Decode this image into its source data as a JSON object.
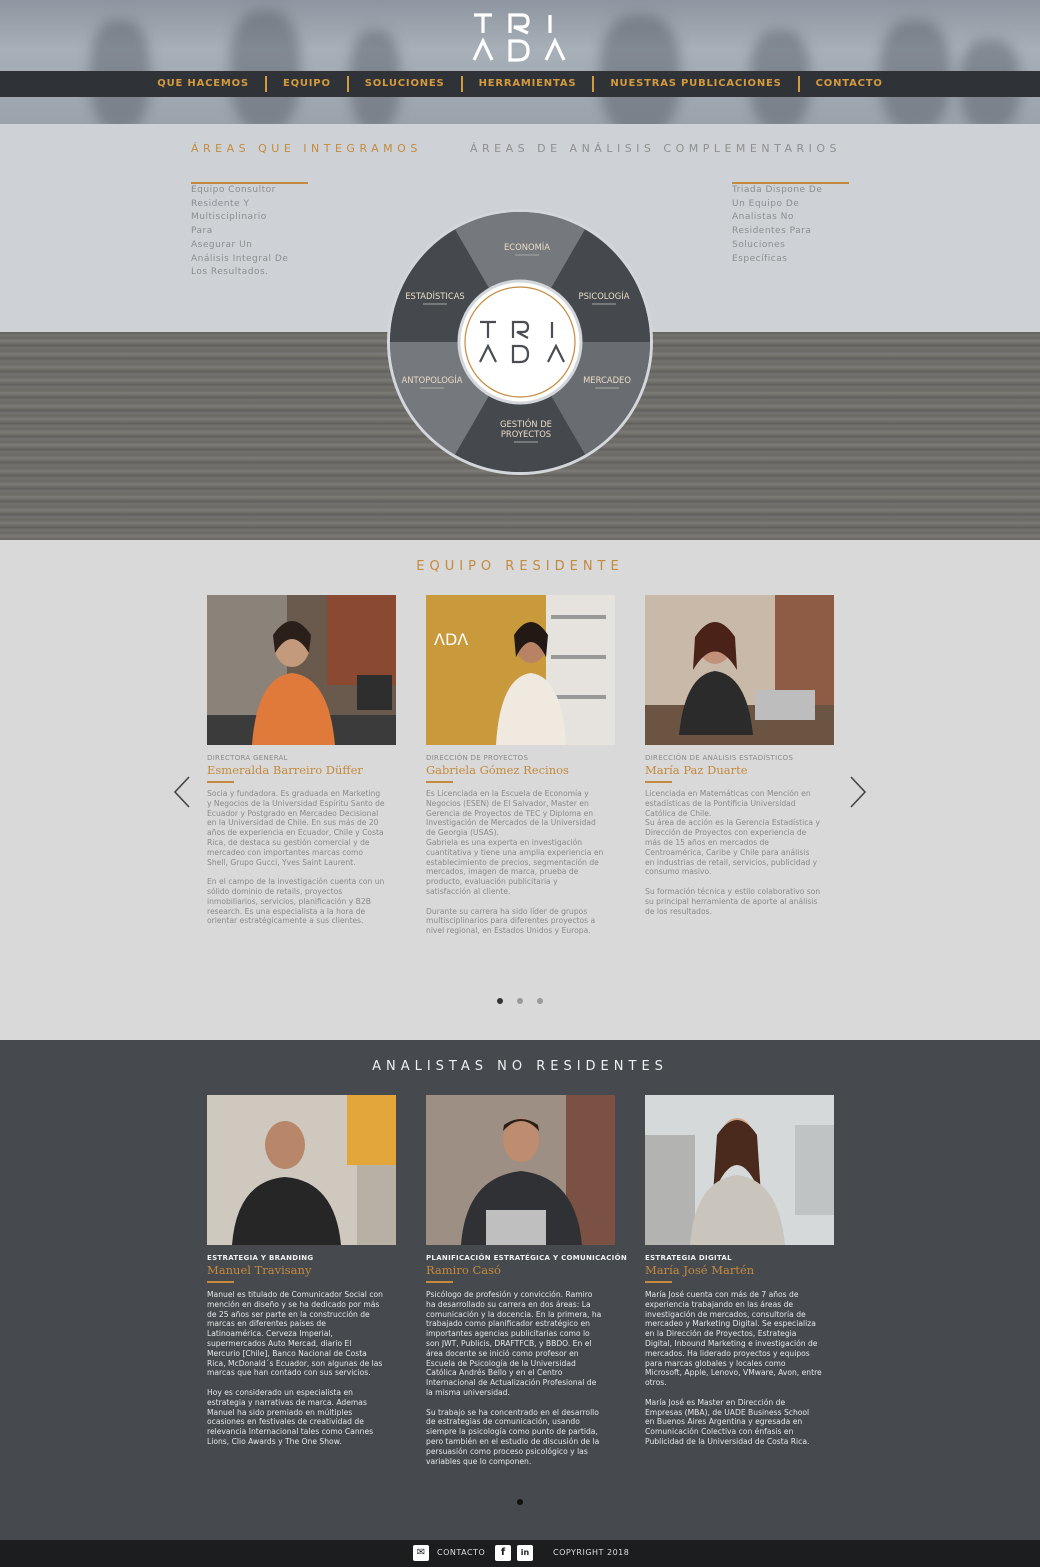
{
  "brand": {
    "logo_line1": "TRI",
    "logo_line2": "ADA",
    "accent_color": "#c48a3d"
  },
  "nav": {
    "items": [
      "QUE HACEMOS",
      "EQUIPO",
      "SOLUCIONES",
      "HERRAMIENTAS",
      "NUESTRAS PUBLICACIONES",
      "CONTACTO"
    ]
  },
  "areas": {
    "left_title": "ÁREAS QUE INTEGRAMOS",
    "right_title": "ÁREAS DE ANÁLISIS COMPLEMENTARIOS",
    "left_text": "Equipo Consultor\nResidente Y\nMultisciplinario Para\nAsegurar Un\nAnálisis Integral De\nLos Resultados.",
    "right_text": "Triada Dispone De\nUn Equipo De\nAnalistas No\nResidentes Para\nSoluciones\nEspecíficas",
    "wheel": [
      "ECONOMÍA",
      "PSICOLOGÍA",
      "MERCADEO",
      "GESTIÓN DE",
      "PROYECTOS",
      "ANTOPOLOGÍA",
      "ESTADÍSTICAS"
    ]
  },
  "team": {
    "title": "EQUIPO RESIDENTE",
    "members": [
      {
        "role": "DIRECTORA GENERAL",
        "name": "Esmeralda Barreiro Düffer",
        "bio": "Socia y fundadora. Es graduada en Marketing\ny Negocios de la Universidad Espíritu Santo de\nEcuador y Postgrado en Mercadeo Decisional\nen la Universidad de Chile. En sus más de 20\naños de experiencia en Ecuador, Chile y Costa\nRica, de destaca su gestión comercial y de\nmercadeo con importantes marcas como\nShell, Grupo Gucci, Yves Saint Laurent.\n\nEn el campo de la investigación cuenta con un\nsólido dominio de retails, proyectos\ninmobiliarios, servicios, planificación y B2B\nresearch. Es una especialista a la hora de\norientar estratégicamente a sus clientes."
      },
      {
        "role": "DIRECCIÓN DE PROYECTOS",
        "name": "Gabriela Gómez Recinos",
        "bio": "Es Licenciada en la Escuela de Economía y\nNegocios (ESEN) de El Salvador, Master en\nGerencia de Proyectos de TEC y Diploma en\nInvestigación de Mercados de la Universidad\nde Georgia (USAS).\nGabriela es una experta en investigación\ncuantitativa y tiene una amplia experiencia en\nestablecimiento de precios, segmentación de\nmercados, imagen de marca, prueba de\nproducto, evaluación publicitaria y\nsatisfacción al cliente.\n\nDurante su carrera ha sido líder de grupos\nmultisciplinarios para diferentes proyectos a\nnivel regional, en Estados Unidos y Europa."
      },
      {
        "role": "DIRECCIÓN DE ANÁLISIS ESTADÍSTICOS",
        "name": "María Paz Duarte",
        "bio": "Licenciada en Matemáticas con Mención en\nestadísticas de la Pontificia Universidad\nCatólica de Chile.\nSu área de acción es la Gerencia Estadística y\nDirección de Proyectos con experiencia de\nmás de 15 años en mercados de\nCentroamérica, Caribe y Chile para análisis\nen industrias de retail, servicios, publicidad y\nconsumo masivo.\n\nSu formación técnica y estilo colaborativo son\nsu principal herramienta de aporte al análisis\nde los resultados."
      }
    ]
  },
  "analysts": {
    "title": "ANALISTAS NO RESIDENTES",
    "members": [
      {
        "role": "ESTRATEGIA Y BRANDING",
        "name": "Manuel Travisany",
        "bio": "Manuel es titulado de Comunicador Social con\nmención en diseño y se ha dedicado por más\nde 25 años ser parte en la construcción de\nmarcas en diferentes países de\nLatinoamérica. Cerveza Imperial,\nsupermercados Auto Mercad, diario El\nMercurio [Chile], Banco Nacional de Costa\nRica, McDonald´s Ecuador, son algunas de las\nmarcas que han contado con sus servicios.\n\nHoy es considerado un especialista en\nestrategia y narrativas de marca. Ademas\nManuel ha sido premiado en múltiples\nocasiones en festivales de creatividad de\nrelevancia Internacional tales como Cannes\nLions, Clio Awards y The One Show."
      },
      {
        "role": "PLANIFICACIÓN ESTRATÉGICA Y COMUNICACIÓN",
        "name": "Ramiro Casó",
        "bio": "Psicólogo de profesión y convicción. Ramiro\nha desarrollado su carrera en dos áreas: La\ncomunicación y la docencia. En la primera, ha\ntrabajado como planificador estratégico en\nimportantes agencias publicitarias como lo\nson JWT, Publicis, DRAFTFCB, y BBDO. En el\nárea docente se inició como profesor en\nEscuela de Psicología de la Universidad\nCatólica Andrés Bello y en el Centro\nInternacional de Actualización Profesional de\nla misma universidad.\n\nSu trabajo se ha concentrado en el desarrollo\nde estrategias de comunicación, usando\nsiempre la psicología como punto de partida,\npero también en el estudio de discusión de la\npersuasión como proceso psicológico y las\nvariables que lo componen."
      },
      {
        "role": "ESTRATEGIA DIGITAL",
        "name": "María José Martén",
        "bio": "María José cuenta con más de 7 años de\nexperiencia trabajando en las áreas de\ninvestigación de mercados, consultoría de\nmercadeo y Marketing Digital. Se especializa\nen la Dirección de Proyectos, Estrategia\nDigital, Inbound Marketing e investigación de\nmercados. Ha liderado proyectos y equipos\npara marcas globales y locales como\nMicrosoft, Apple, Lenovo, VMware, Avon, entre\notros.\n\nMaría José es Master en Dirección de\nEmpresas (MBA), de UADE Business School\nen Buenos Aires Argentina y egresada en\nComunicación Colectiva con énfasis en\nPublicidad de la Universidad de Costa Rica."
      }
    ]
  },
  "footer": {
    "contact": "CONTACTO",
    "copyright": "COPYRIGHT 2018",
    "facebook_icon": "f",
    "linkedin_icon": "in"
  }
}
